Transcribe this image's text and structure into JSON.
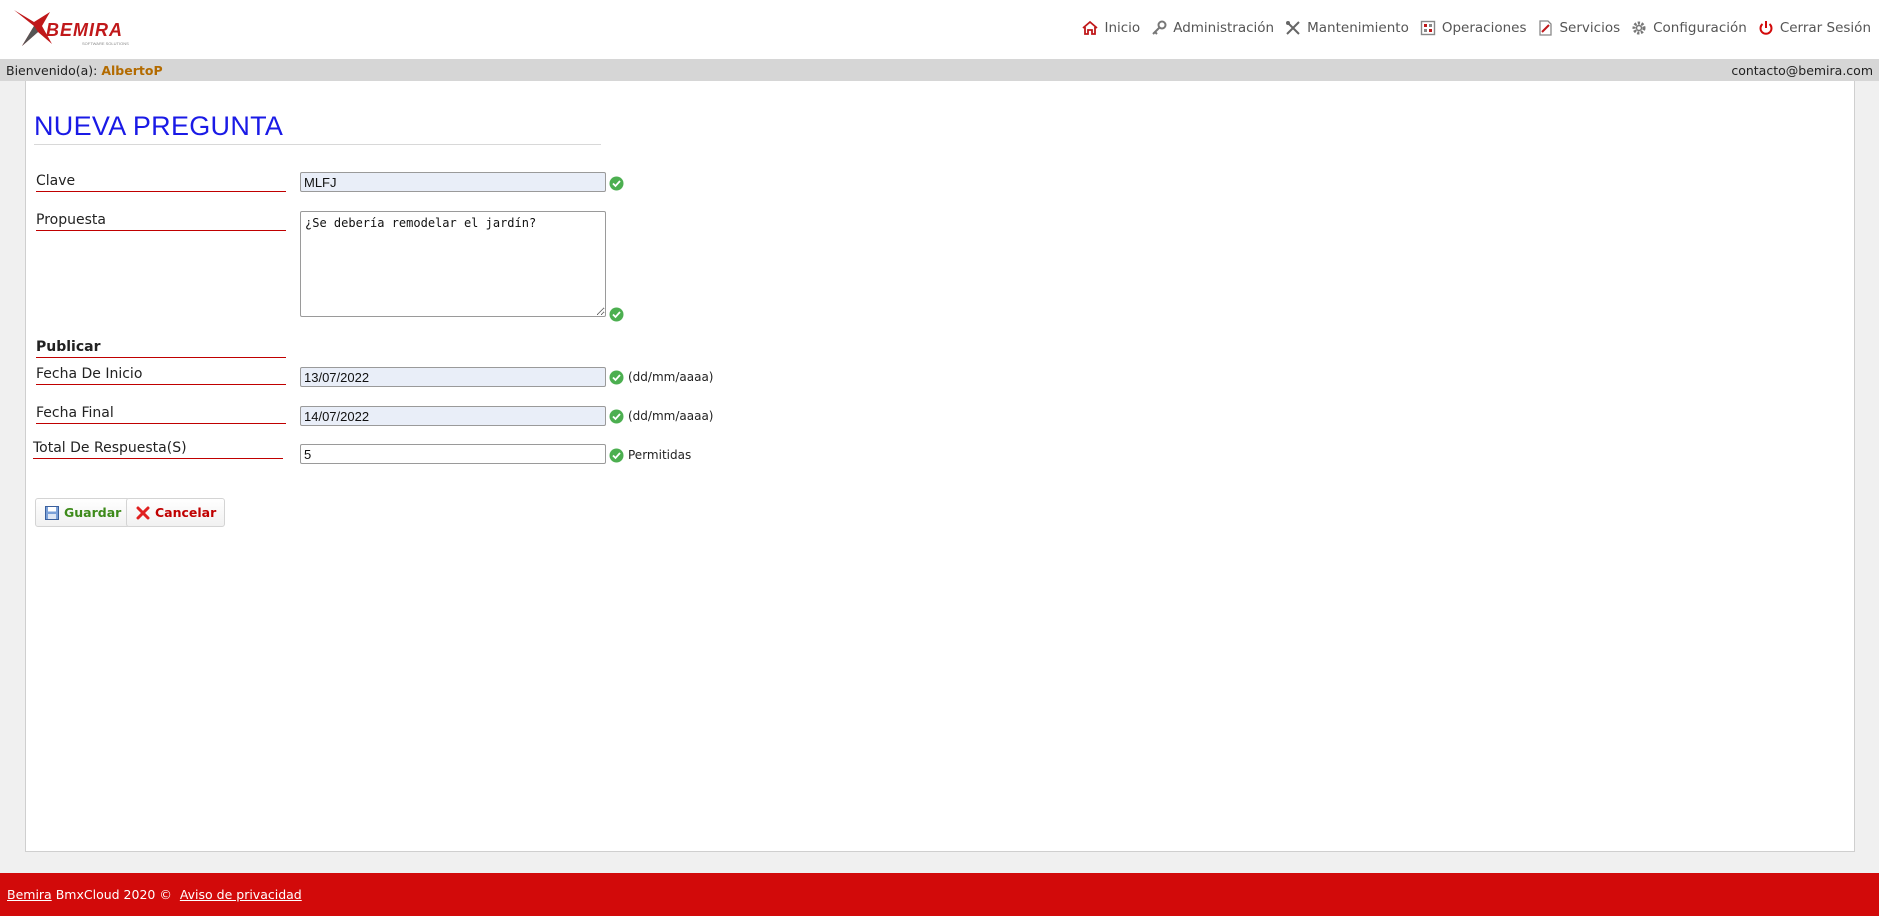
{
  "header": {
    "logo_text": "BEMIRA",
    "nav": [
      {
        "label": "Inicio",
        "icon": "home-icon"
      },
      {
        "label": "Administración",
        "icon": "key-icon"
      },
      {
        "label": "Mantenimiento",
        "icon": "tools-icon"
      },
      {
        "label": "Operaciones",
        "icon": "calculator-icon"
      },
      {
        "label": "Servicios",
        "icon": "document-edit-icon"
      },
      {
        "label": "Configuración",
        "icon": "gear-icon"
      },
      {
        "label": "Cerrar Sesión",
        "icon": "power-icon"
      }
    ]
  },
  "welcome": {
    "prefix": "Bienvenido(a):",
    "user": "AlbertoP",
    "email": "contacto@bemira.com"
  },
  "form": {
    "title": "NUEVA PREGUNTA",
    "clave_label": "Clave",
    "clave_value": "MLFJ",
    "propuesta_label": "Propuesta",
    "propuesta_value": "¿Se debería remodelar el jardín?",
    "publicar_label": "Publicar",
    "fecha_inicio_label": "Fecha De Inicio",
    "fecha_inicio_value": "13/07/2022",
    "fecha_final_label": "Fecha Final",
    "fecha_final_value": "14/07/2022",
    "date_hint": "(dd/mm/aaaa)",
    "total_label": "Total De Respuesta(S)",
    "total_value": "5",
    "total_hint": "Permitidas",
    "save_label": "Guardar",
    "cancel_label": "Cancelar"
  },
  "footer": {
    "brand": "Bemira",
    "text": "BmxCloud 2020 ©",
    "privacy": "Aviso de privacidad"
  },
  "colors": {
    "accent_red": "#d20a0a",
    "title_blue": "#1a1ae6",
    "ok_green": "#4caf50"
  }
}
